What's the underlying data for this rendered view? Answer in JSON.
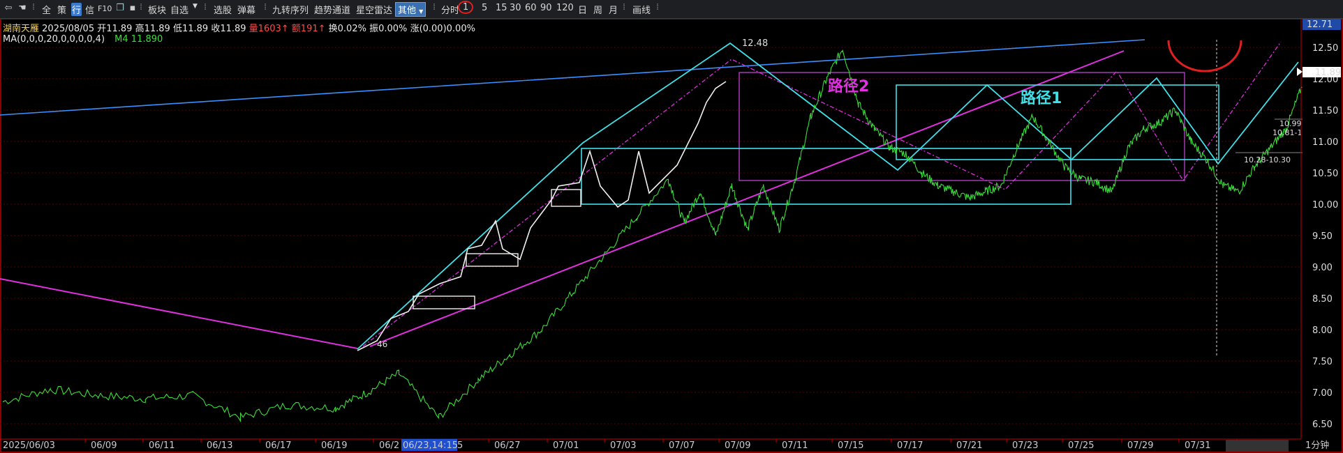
{
  "toolbar": {
    "items": [
      "全",
      "策",
      "行",
      "信",
      "F10",
      "板块",
      "自选",
      "选股",
      "弹幕",
      "九转序列",
      "趋势通道",
      "星空雷达",
      "其他",
      "分时",
      "1",
      "5",
      "15",
      "30",
      "60",
      "90",
      "120",
      "日",
      "周",
      "月",
      "画线"
    ]
  },
  "quote": {
    "name": "湖南天雁",
    "date": "2025/08/05",
    "open": "开11.89",
    "high": "高11.89",
    "low": "低11.89",
    "close": "收11.89",
    "volume": "量1603↑",
    "amount": "额191↑",
    "turnover": "换0.02%",
    "amplitude": "振0.00%",
    "change": "涨(0.00)0.00%"
  },
  "ma": {
    "params": "MA(0,0,0,20,0,0,0,0,4)",
    "m4": "M4 11.890"
  },
  "colors": {
    "price_line": "#3cdc3c",
    "cyan": "#40e0e8",
    "magenta": "#e030e0",
    "blue_trend": "#3a8fff",
    "grid": "#6a0000",
    "red_mark": "#e02020"
  },
  "chart_data": {
    "type": "line",
    "title": "",
    "y_ticks": [
      "12.50",
      "12.00",
      "11.50",
      "11.00",
      "10.50",
      "10.00",
      "9.50",
      "9.00",
      "8.50",
      "8.00",
      "7.50",
      "7.00",
      "6.50"
    ],
    "y_top_label": "12.71",
    "current_price_label": "11.89",
    "ylim": [
      6.4,
      12.75
    ],
    "x_ticks": [
      "2025/06/03",
      "06/09",
      "06/11",
      "06/13",
      "06/17",
      "06/19",
      "06/2",
      "06/27",
      "07/01",
      "07/03",
      "07/07",
      "07/09",
      "07/11",
      "07/15",
      "07/17",
      "07/21",
      "07/23",
      "07/25",
      "07/29",
      "07/31",
      "08/04"
    ],
    "crosshair_x_label": "06/23,14:15",
    "crosshair_x_suffix": "5",
    "period_label": "1分钟",
    "annotations": {
      "high": "12.48",
      "low": "46",
      "path1": "路径1",
      "path2": "路径2",
      "lbl_1099": "10.99",
      "lbl_1081": "10.81-1",
      "lbl_1028": "10.28-10.30"
    },
    "series": [
      {
        "values": [
          [
            0,
            6.85
          ],
          [
            0.06,
            7.05
          ],
          [
            0.12,
            6.95
          ],
          [
            0.18,
            6.9
          ],
          [
            0.24,
            6.95
          ],
          [
            0.3,
            6.6
          ],
          [
            0.36,
            6.8
          ],
          [
            0.42,
            6.75
          ],
          [
            0.46,
            7.0
          ],
          [
            0.5,
            7.3
          ],
          [
            0.55,
            6.6
          ],
          [
            0.6,
            7.2
          ],
          [
            0.64,
            7.6
          ],
          [
            0.68,
            8.0
          ],
          [
            0.72,
            8.6
          ],
          [
            0.76,
            9.2
          ],
          [
            0.8,
            9.8
          ],
          [
            0.84,
            10.4
          ],
          [
            0.86,
            9.7
          ],
          [
            0.88,
            10.2
          ],
          [
            0.9,
            9.5
          ],
          [
            0.92,
            10.3
          ],
          [
            0.94,
            9.6
          ],
          [
            0.96,
            10.3
          ],
          [
            0.98,
            9.6
          ],
          [
            1.0,
            10.4
          ],
          [
            1.02,
            11.4
          ],
          [
            1.04,
            12.0
          ],
          [
            1.06,
            12.48
          ],
          [
            1.08,
            11.6
          ],
          [
            1.1,
            11.2
          ],
          [
            1.12,
            10.9
          ],
          [
            1.14,
            10.8
          ],
          [
            1.16,
            10.5
          ],
          [
            1.18,
            10.3
          ],
          [
            1.2,
            10.2
          ],
          [
            1.22,
            10.1
          ],
          [
            1.24,
            10.2
          ],
          [
            1.26,
            10.3
          ],
          [
            1.28,
            10.9
          ],
          [
            1.3,
            11.4
          ],
          [
            1.32,
            11.0
          ],
          [
            1.34,
            10.6
          ],
          [
            1.36,
            10.4
          ],
          [
            1.38,
            10.35
          ],
          [
            1.4,
            10.2
          ],
          [
            1.42,
            10.9
          ],
          [
            1.44,
            11.2
          ],
          [
            1.46,
            11.3
          ],
          [
            1.48,
            11.5
          ],
          [
            1.5,
            11.0
          ],
          [
            1.52,
            10.7
          ],
          [
            1.54,
            10.3
          ],
          [
            1.56,
            10.2
          ],
          [
            1.58,
            10.6
          ],
          [
            1.6,
            10.9
          ],
          [
            1.62,
            11.2
          ],
          [
            1.64,
            11.89
          ]
        ]
      }
    ]
  }
}
